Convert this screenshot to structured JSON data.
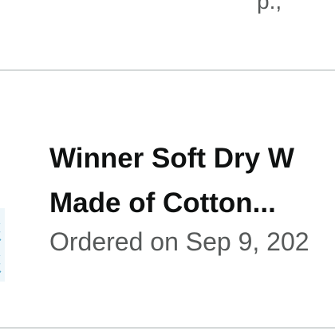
{
  "previous_item": {
    "trailing_text": "p., "
  },
  "order": {
    "title_line1": "Winner Soft Dry W",
    "title_line2": "Made of Cotton...",
    "ordered_on": "Ordered on Sep 9, 202"
  },
  "colors": {
    "title": "#0f1111",
    "secondary": "#565959",
    "divider": "#d5d9d9",
    "thumbnail_tint": "#5aa8c9"
  },
  "icons": {
    "thumbnail": "towel-product-image"
  }
}
